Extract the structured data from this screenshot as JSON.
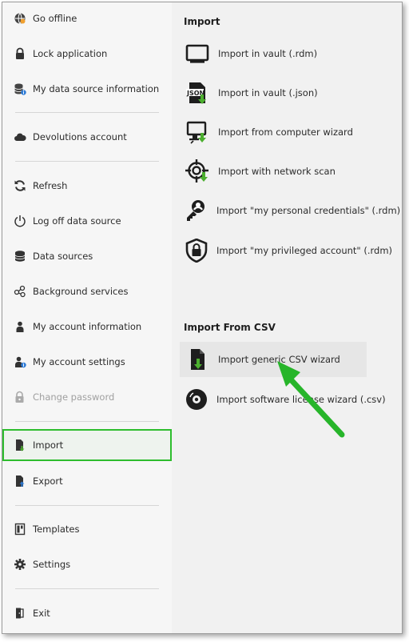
{
  "left_menu": {
    "go_offline": "Go offline",
    "lock_application": "Lock application",
    "my_data_source_information": "My data source information",
    "devolutions_account": "Devolutions account",
    "refresh": "Refresh",
    "log_off_data_source": "Log off data source",
    "data_sources": "Data sources",
    "background_services": "Background services",
    "my_account_information": "My account information",
    "my_account_settings": "My account settings",
    "change_password": "Change password",
    "import": "Import",
    "export": "Export",
    "templates": "Templates",
    "settings": "Settings",
    "exit": "Exit"
  },
  "import_section": {
    "title": "Import",
    "items": [
      {
        "label": "Import in vault (.rdm)",
        "icon": "monitor-icon"
      },
      {
        "label": "Import in vault (.json)",
        "icon": "json-import-icon"
      },
      {
        "label": "Import from computer wizard",
        "icon": "computer-import-icon"
      },
      {
        "label": "Import with network scan",
        "icon": "network-scan-icon"
      },
      {
        "label": "Import \"my personal credentials\" (.rdm)",
        "icon": "key-user-icon"
      },
      {
        "label": "Import \"my privileged account\" (.rdm)",
        "icon": "shield-lock-icon"
      }
    ]
  },
  "csv_section": {
    "title": "Import From CSV",
    "items": [
      {
        "label": "Import generic CSV wizard",
        "icon": "csv-import-icon"
      },
      {
        "label": "Import software license wizard (.csv)",
        "icon": "disc-icon"
      }
    ]
  },
  "colors": {
    "selection_outline": "#2ebd2e",
    "arrow": "#27b52a",
    "import_accent": "#4caf2f"
  }
}
